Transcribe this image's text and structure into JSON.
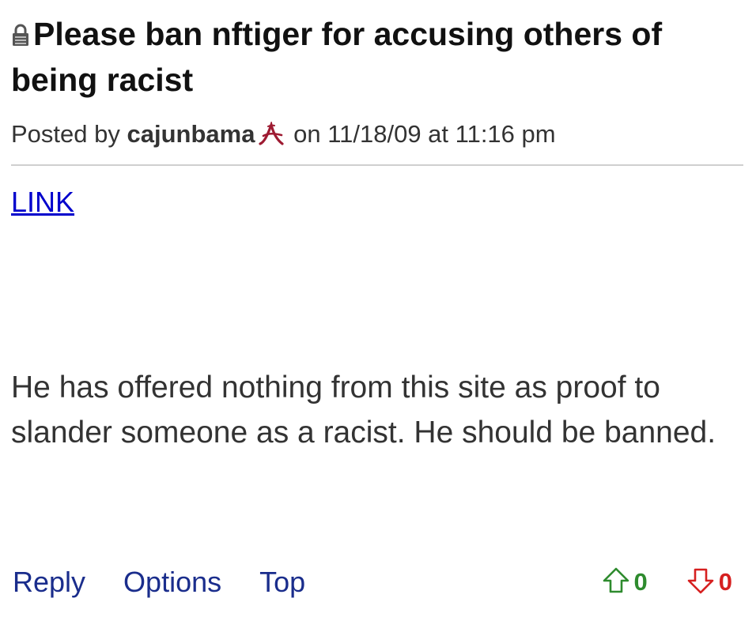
{
  "post": {
    "title": "Please ban nftiger for accusing others of being racist",
    "meta": {
      "posted_by_label": "Posted by",
      "author": "cajunbama",
      "on_label": "on",
      "datetime": "11/18/09 at 11:16 pm"
    },
    "link_label": "LINK",
    "body": "He has offered nothing from this site as proof to slander someone as a racist. He should be banned."
  },
  "actions": {
    "reply": "Reply",
    "options": "Options",
    "top": "Top"
  },
  "votes": {
    "up_count": "0",
    "down_count": "0",
    "up_color": "#2e8b2e",
    "down_color": "#d62020"
  },
  "colors": {
    "link": "#0000cc",
    "action": "#1a2d8c",
    "team_logo": "#9e1b32"
  },
  "icons": {
    "title": "lock-icon",
    "author_badge": "team-logo-icon",
    "upvote": "arrow-up-icon",
    "downvote": "arrow-down-icon"
  }
}
